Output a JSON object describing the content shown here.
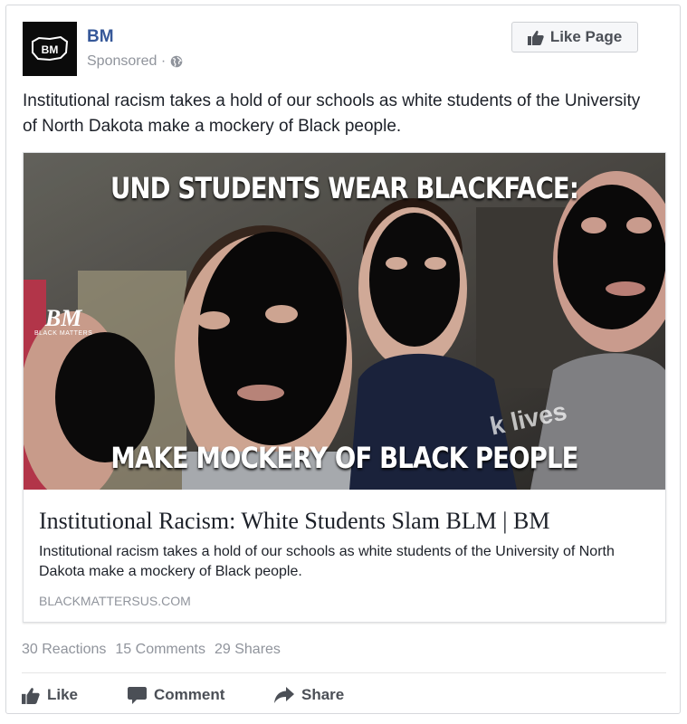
{
  "post": {
    "page_name": "BM",
    "avatar_text": "BM",
    "sponsored": "Sponsored ·",
    "like_page_label": "Like Page",
    "text": "Institutional racism takes a hold of our schools as white students of the University of North Dakota make a mockery of Black people."
  },
  "link": {
    "image_caption_top": "UND STUDENTS WEAR BLACKFACE:",
    "image_caption_bottom": "MAKE MOCKERY OF BLACK PEOPLE",
    "watermark_logo": "BM",
    "watermark_sub": "BLACK MATTERS",
    "shirt_text": "k lives",
    "title": "Institutional Racism: White Students Slam BLM | BM",
    "description": "Institutional racism takes a hold of our schools as white students of the University of North Dakota make a mockery of Black people.",
    "domain": "BLACKMATTERSUS.COM"
  },
  "stats": {
    "reactions": "30 Reactions",
    "comments": "15 Comments",
    "shares": "29 Shares"
  },
  "actions": {
    "like": "Like",
    "comment": "Comment",
    "share": "Share"
  },
  "icons": [
    "globe-icon",
    "thumbs-up-icon",
    "comment-icon",
    "share-icon"
  ],
  "colors": {
    "page_name": "#365899",
    "meta": "#90949c",
    "text": "#1d2129",
    "action": "#4b4f56"
  }
}
